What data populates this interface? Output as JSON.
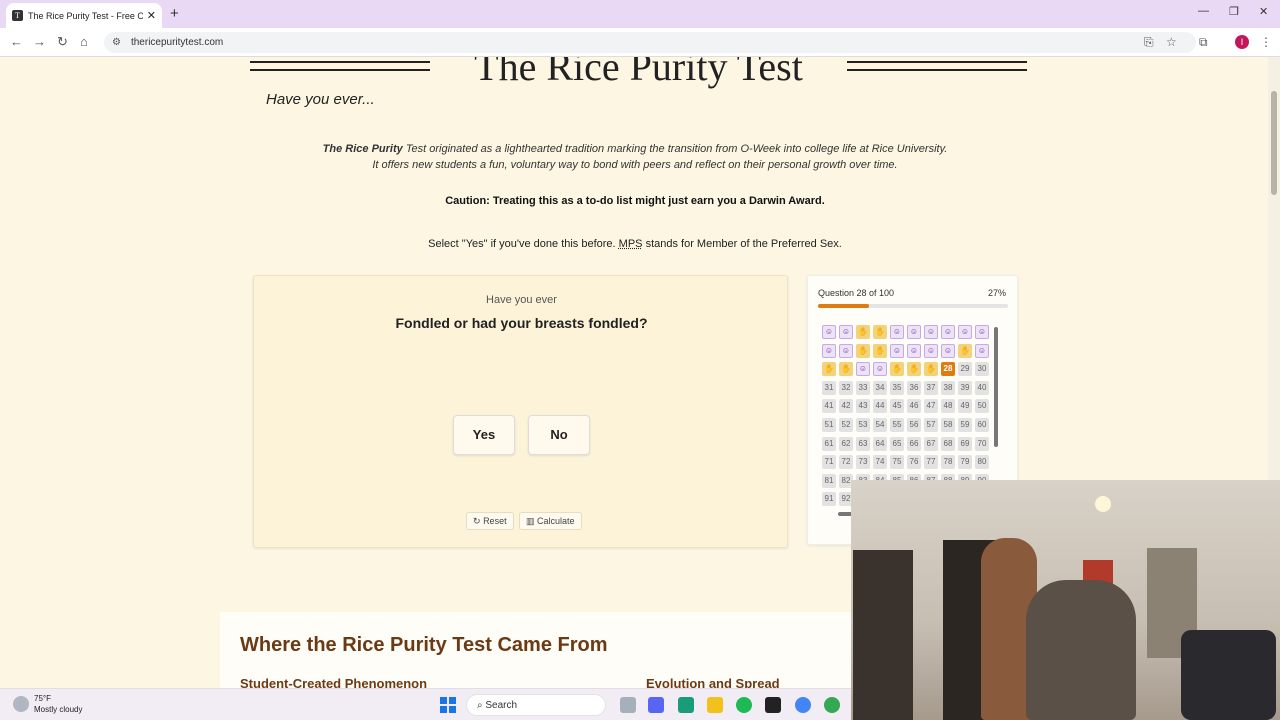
{
  "browser": {
    "tab_title": "The Rice Purity Test - Free Onli",
    "favicon_letter": "T",
    "url": "thericepuritytest.com",
    "profile_letter": "I"
  },
  "page": {
    "title": "The Rice Purity Test",
    "subtitle": "Have you ever...",
    "intro_bold": "The Rice Purity",
    "intro_line1": "Test originated as a lighthearted tradition marking the transition from O-Week into college life at Rice University.",
    "intro_line2": "It offers new students a fun, voluntary way to bond with peers and reflect on their personal growth over time.",
    "caution_label": "Caution:",
    "caution_text": "Treating this as a to-do list might just earn you a Darwin Award.",
    "instruction_before": "Select \"Yes\" if you've done this before.",
    "instruction_abbr": "MPS",
    "instruction_after": "stands for Member of the Preferred Sex."
  },
  "question_card": {
    "prompt": "Have you ever",
    "question": "Fondled or had your breasts fondled?",
    "yes_label": "Yes",
    "no_label": "No",
    "reset_label": "Reset",
    "calculate_label": "Calculate"
  },
  "progress": {
    "label": "Question 28 of 100",
    "percent_text": "27%",
    "fraction": 0.27,
    "current": 28,
    "answers": [
      "no",
      "no",
      "yes",
      "yes",
      "no",
      "no",
      "no",
      "no",
      "no",
      "no",
      "no",
      "no",
      "yes",
      "yes",
      "no",
      "no",
      "no",
      "no",
      "yes",
      "no",
      "yes",
      "yes",
      "no",
      "no",
      "yes",
      "yes",
      "yes"
    ]
  },
  "history": {
    "title": "Where the Rice Purity Test Came From",
    "left_sub": "Student-Created Phenomenon",
    "right_sub": "Evolution and Spread"
  },
  "taskbar": {
    "temp": "75°F",
    "weather": "Mostly cloudy",
    "search_label": "Search"
  }
}
